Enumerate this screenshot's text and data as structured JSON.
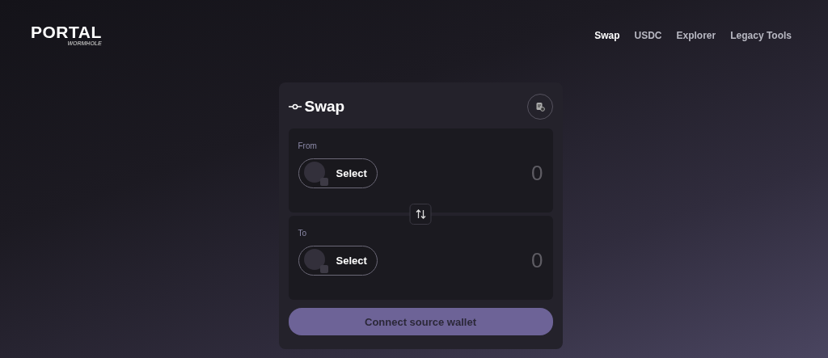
{
  "logo": {
    "title": "PORTAL",
    "subtitle": "WORMHOLE"
  },
  "nav": [
    {
      "label": "Swap",
      "selected": true
    },
    {
      "label": "USDC",
      "selected": false
    },
    {
      "label": "Explorer",
      "selected": false
    },
    {
      "label": "Legacy Tools",
      "selected": false
    }
  ],
  "swap_card": {
    "title": "Swap",
    "panels": [
      {
        "label": "From",
        "token_button": "Select",
        "amount": "0"
      },
      {
        "label": "To",
        "token_button": "Select",
        "amount": "0"
      }
    ],
    "connect_button": "Connect source wallet"
  }
}
